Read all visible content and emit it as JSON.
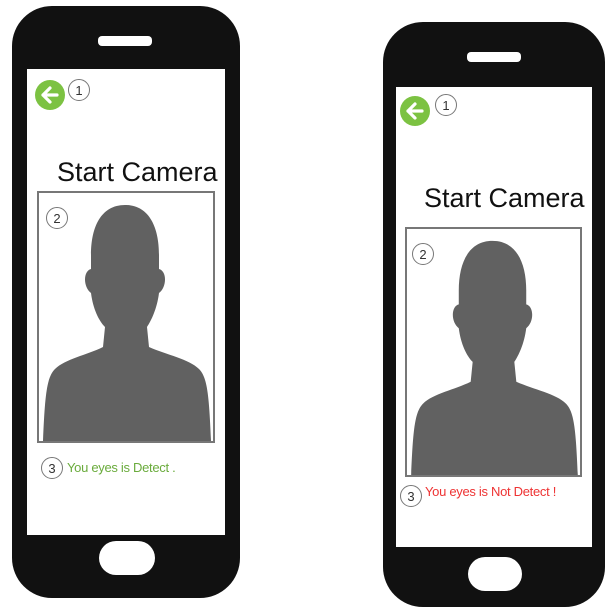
{
  "screens": [
    {
      "back_marker": "1",
      "title": "Start Camera",
      "camera_marker": "2",
      "status_marker": "3",
      "status_text": "You eyes is Detect .",
      "status_color": "#6aab3c"
    },
    {
      "back_marker": "1",
      "title": "Start Camera",
      "camera_marker": "2",
      "status_marker": "3",
      "status_text": "You eyes is Not Detect !",
      "status_color": "#ee3333"
    }
  ],
  "icons": {
    "back": "arrow-left-icon",
    "avatar": "person-silhouette-icon",
    "home": "home-button-icon",
    "speaker": "speaker-slot-icon"
  },
  "colors": {
    "phone_body": "#111111",
    "back_button": "#7cc242",
    "silhouette": "#616161"
  }
}
